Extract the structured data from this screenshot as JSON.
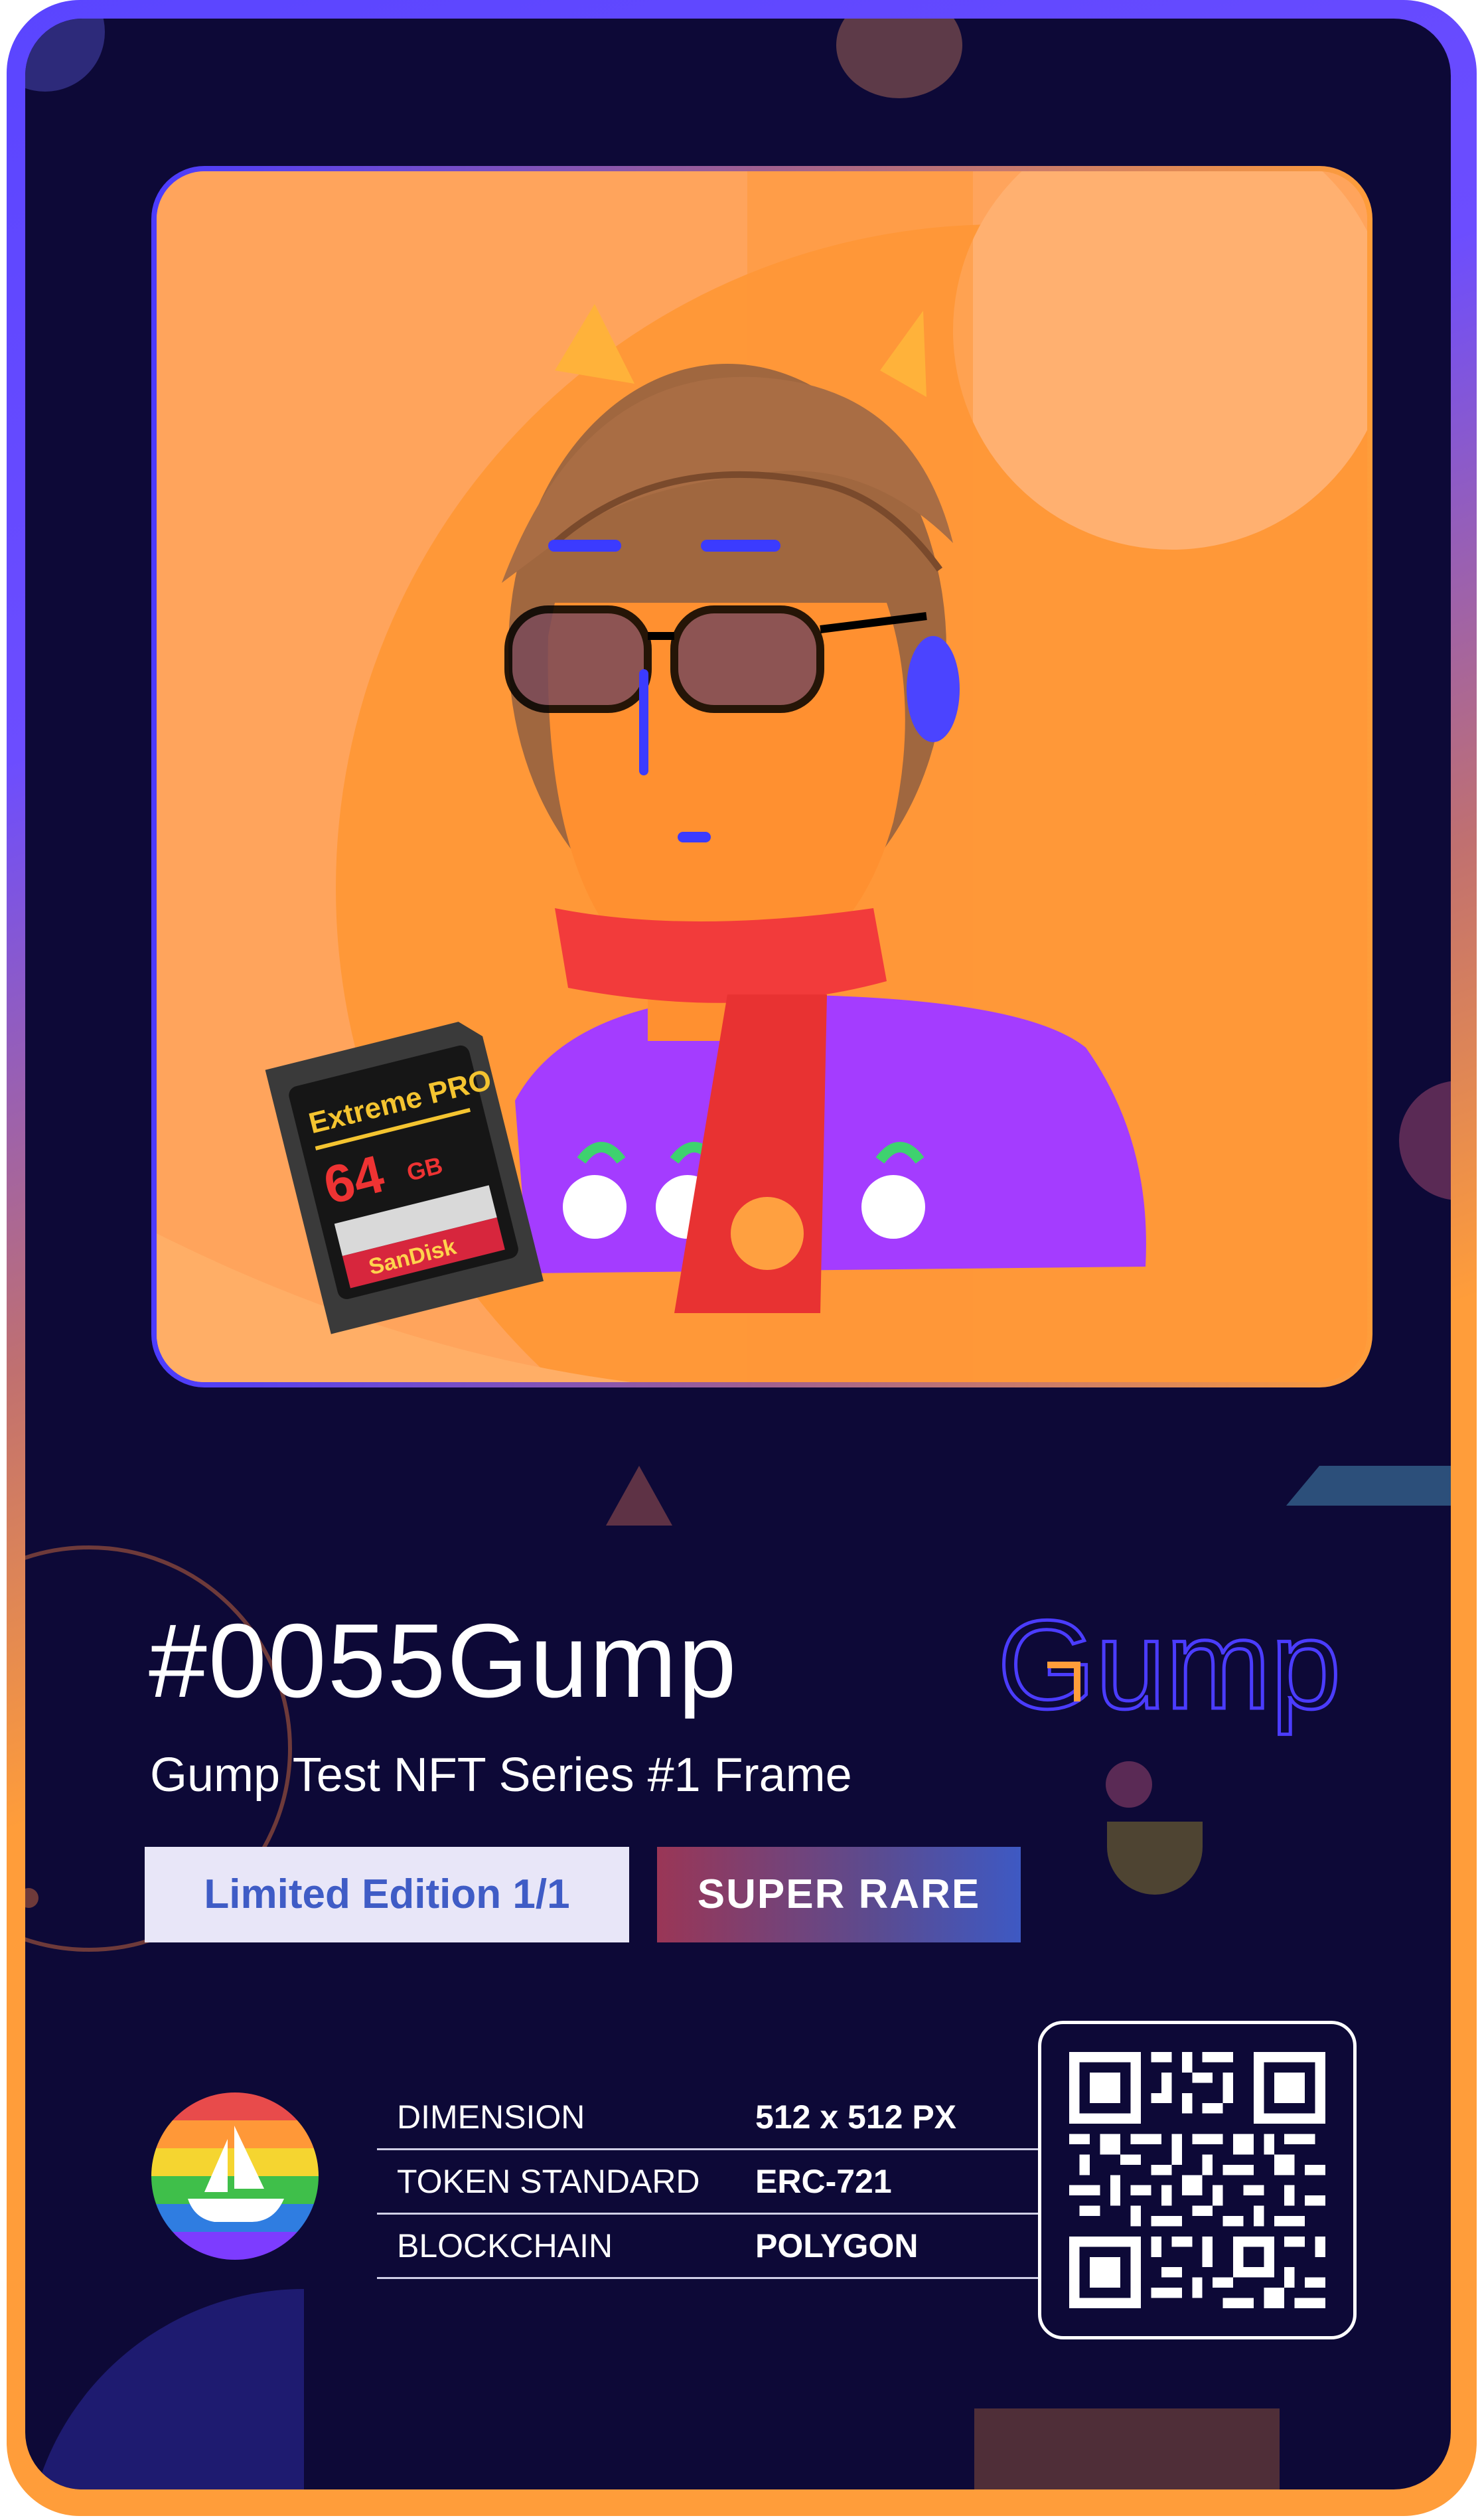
{
  "card": {
    "token_id": "#0055Gump",
    "series_name": "Gump Test NFT Series #1 Frame",
    "edition_badge": "Limited Edition 1/1",
    "rarity_badge": "SUPER RARE",
    "brand_logo_text": "Gump"
  },
  "artwork": {
    "sd_card_brand": "Extreme PRO",
    "sd_card_capacity": "64",
    "sd_card_unit": "GB",
    "sd_card_maker": "SanDisk"
  },
  "specs": [
    {
      "label": "DIMENSION",
      "value": "512 x 512 PX"
    },
    {
      "label": "TOKEN STANDARD",
      "value": "ERC-721"
    },
    {
      "label": "BLOCKCHAIN",
      "value": "POLYGON"
    }
  ],
  "icons": {
    "marketplace": "opensea-icon",
    "qr": "qr-code-icon"
  },
  "colors": {
    "background": "#0d0937",
    "accent_orange": "#ff9d3a",
    "accent_blue": "#4b3cff",
    "edition_text": "#3f5cc6"
  }
}
